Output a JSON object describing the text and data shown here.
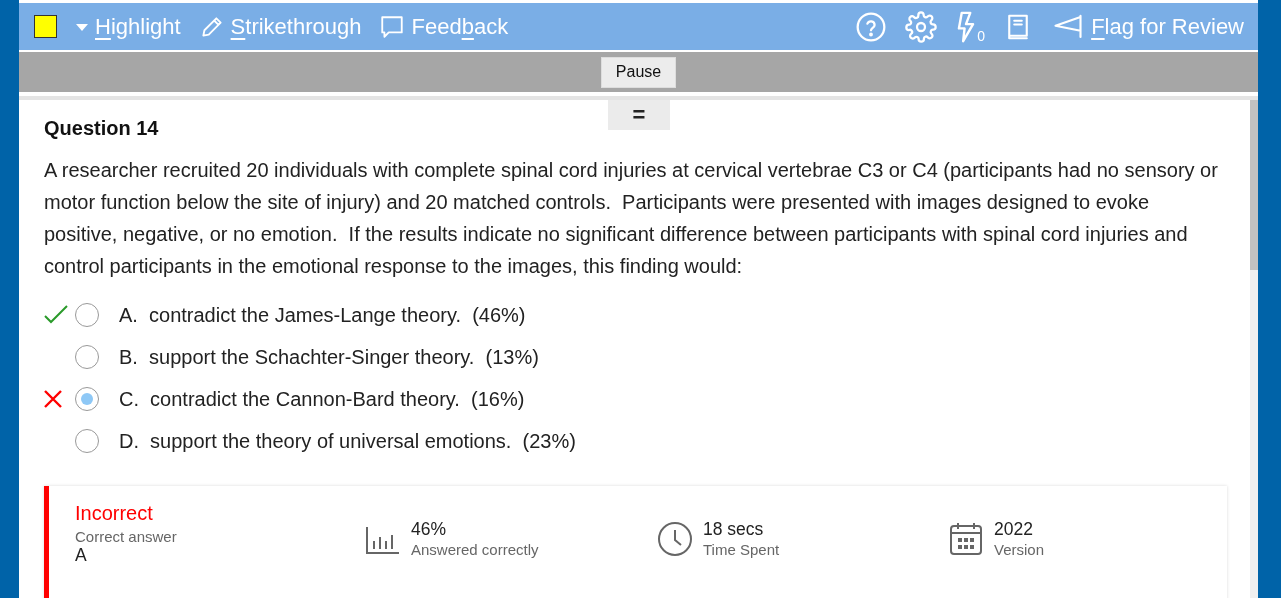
{
  "toolbar": {
    "tools": [
      {
        "kind": "highlight",
        "key": "H",
        "post": "ighlight"
      },
      {
        "kind": "strike",
        "key": "S",
        "post": "trikethrough"
      },
      {
        "kind": "feedback",
        "pre": "Feed",
        "key": "b",
        "post": "ack"
      }
    ],
    "lightning_count": "0",
    "flag": {
      "key": "F",
      "post": "lag for Review"
    }
  },
  "pause_button": "Pause",
  "handle": "=",
  "question": {
    "title": "Question 14",
    "text": "A researcher recruited 20 individuals with complete spinal cord injuries at cervical vertebrae C3 or C4 (participants had no sensory or motor function below the site of injury) and 20 matched controls.  Participants were presented with images designed to evoke positive, negative, or no emotion.  If the results indicate no significant difference between participants with spinal cord injuries and control participants in the emotional response to the images, this finding would:",
    "options": [
      {
        "letter": "A.",
        "text": "contradict the James-Lange theory.",
        "percent": "(46%)",
        "selected": false,
        "kind": "correct"
      },
      {
        "letter": "B.",
        "text": "support the Schachter-Singer theory.",
        "percent": "(13%)",
        "selected": false,
        "kind": "plain"
      },
      {
        "letter": "C.",
        "text": "contradict the Cannon-Bard theory.",
        "percent": "(16%)",
        "selected": true,
        "kind": "incorrect"
      },
      {
        "letter": "D.",
        "text": "support the theory of universal emotions.",
        "percent": "(23%)",
        "selected": false,
        "kind": "plain"
      }
    ]
  },
  "result": {
    "status": "Incorrect",
    "correct_label": "Correct answer",
    "correct_value": "A",
    "stats": [
      {
        "kind": "chart",
        "value": "46%",
        "label": "Answered correctly"
      },
      {
        "kind": "clock",
        "value": "18 secs",
        "label": "Time Spent"
      },
      {
        "kind": "calendar",
        "value": "2022",
        "label": "Version"
      }
    ]
  }
}
